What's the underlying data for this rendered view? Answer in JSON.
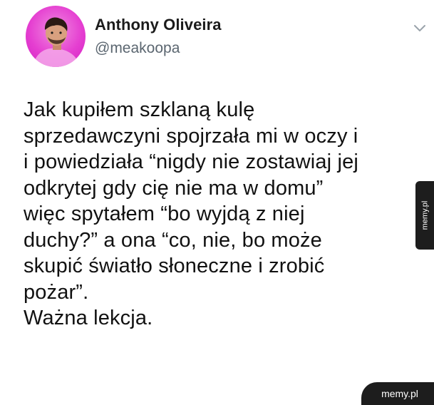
{
  "tweet": {
    "author_name": "Anthony Oliveira",
    "author_handle": "@meakoopa",
    "avatar_color": "#e53fd1",
    "text": "Jak kupiłem szklaną kulę\nsprzedawczyni spojrzała mi w oczy i\ni powiedziała “nigdy nie zostawiaj jej\nodkrytej gdy cię nie ma w domu”\nwięc spytałem “bo wyjdą z niej\nduchy?” a ona “co, nie, bo może\nskupić światło słoneczne i zrobić\npożar”.\nWażna lekcja.",
    "menu_icon": "chevron-down-icon"
  },
  "watermarks": {
    "side": "memy.pl",
    "corner": "memy.pl"
  }
}
